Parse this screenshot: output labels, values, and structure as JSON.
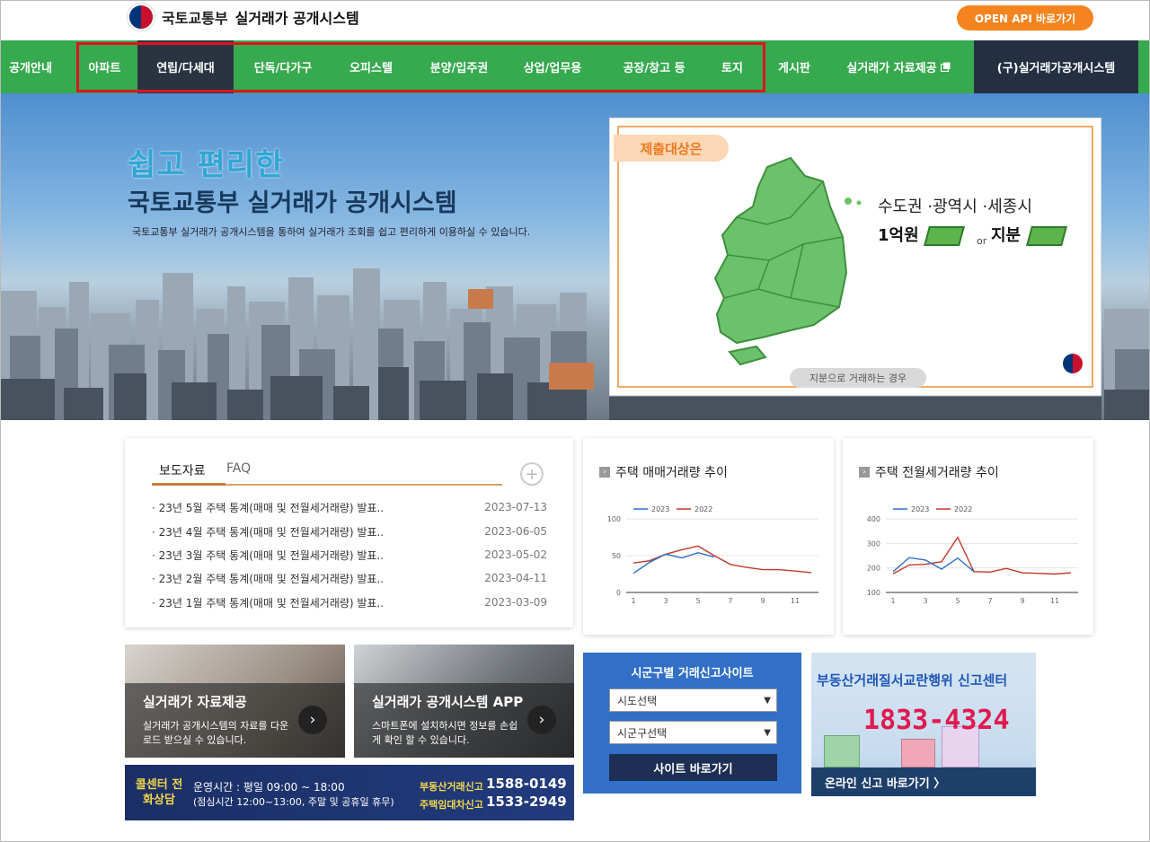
{
  "header": {
    "ministry": "국토교통부",
    "system_name": "실거래가 공개시스템",
    "api_button": "OPEN API 바로가기"
  },
  "nav": {
    "items": [
      {
        "label": "공개안내"
      },
      {
        "label": "아파트"
      },
      {
        "label": "연립/다세대",
        "active": true
      },
      {
        "label": "단독/다가구"
      },
      {
        "label": "오피스텔"
      },
      {
        "label": "분양/입주권"
      },
      {
        "label": "상업/업무용"
      },
      {
        "label": "공장/창고 등"
      },
      {
        "label": "토지"
      },
      {
        "label": "게시판"
      },
      {
        "label": "실거래가 자료제공"
      },
      {
        "label": "(구)실거래가공개시스템"
      }
    ],
    "external_icon": "external-link-icon",
    "colors": {
      "bar": "#37a94f",
      "active": "#2a3441",
      "old_system": "#243042",
      "highlight_box": "#e0141e"
    }
  },
  "hero": {
    "title_line1": "쉽고 편리한",
    "title_line2": "국토교통부 실거래가 공개시스템",
    "description": "국토교통부 실거래가 공개시스템을 통하여 실거래가 조회를 쉽고 편리하게 이용하실 수 있습니다.",
    "promo": {
      "tag": "제출대상은",
      "line1": "수도권 ·광역시 ·세종시",
      "amount": "1억원",
      "or": "or",
      "share": "지분",
      "caption": "지분으로 거래하는 경우",
      "emblem_caption": "국토교통부"
    }
  },
  "news": {
    "tabs": [
      "보도자료",
      "FAQ"
    ],
    "items": [
      {
        "title": "23년 5월 주택 통계(매매 및 전월세거래량) 발표..",
        "date": "2023-07-13"
      },
      {
        "title": "23년 4월 주택 통계(매매 및 전월세거래량) 발표..",
        "date": "2023-06-05"
      },
      {
        "title": "23년 3월 주택 통계(매매 및 전월세거래량) 발표..",
        "date": "2023-05-02"
      },
      {
        "title": "23년 2월 주택 통계(매매 및 전월세거래량) 발표..",
        "date": "2023-04-11"
      },
      {
        "title": "23년 1월 주택 통계(매매 및 전월세거래량) 발표..",
        "date": "2023-03-09"
      }
    ],
    "more_icon": "plus-circle-icon"
  },
  "chart_data": [
    {
      "type": "line",
      "title": "주택 매매거래량 추이",
      "x": [
        1,
        2,
        3,
        4,
        5,
        6,
        7,
        8,
        9,
        10,
        11,
        12
      ],
      "x_ticks": [
        "1",
        "3",
        "5",
        "7",
        "9",
        "11"
      ],
      "ylim": [
        0,
        100
      ],
      "y_ticks": [
        "0",
        "50",
        "100"
      ],
      "grid": true,
      "legend": "top-left",
      "series": [
        {
          "name": "2023",
          "color": "#2f6fc3",
          "values": [
            26,
            41,
            52,
            47,
            54,
            48,
            null,
            null,
            null,
            null,
            null,
            null
          ]
        },
        {
          "name": "2022",
          "color": "#c0392b",
          "values": [
            40,
            43,
            52,
            58,
            63,
            50,
            38,
            34,
            31,
            31,
            29,
            27
          ]
        }
      ]
    },
    {
      "type": "line",
      "title": "주택 전월세거래량 추이",
      "x": [
        1,
        2,
        3,
        4,
        5,
        6,
        7,
        8,
        9,
        10,
        11,
        12
      ],
      "x_ticks": [
        "1",
        "3",
        "5",
        "7",
        "9",
        "11"
      ],
      "ylim": [
        100,
        400
      ],
      "y_ticks": [
        "100",
        "200",
        "300",
        "400"
      ],
      "grid": true,
      "legend": "top-left",
      "series": [
        {
          "name": "2023",
          "color": "#2f6fc3",
          "values": [
            185,
            242,
            232,
            195,
            240,
            185,
            null,
            null,
            null,
            null,
            null,
            null
          ]
        },
        {
          "name": "2022",
          "color": "#c0392b",
          "values": [
            176,
            212,
            215,
            225,
            325,
            185,
            183,
            198,
            180,
            178,
            175,
            180
          ]
        }
      ]
    }
  ],
  "tiles": {
    "data": {
      "title": "실거래가 자료제공",
      "desc": "실거래가 공개시스템의 자료를 다운로드 받으실 수 있습니다."
    },
    "app": {
      "title": "실거래가 공개시스템 APP",
      "desc": "스마트폰에 설치하시면 정보를 손쉽게 확인 할 수 있습니다."
    }
  },
  "callcenter": {
    "label": "콜센터 전화상담",
    "hours": "운영시간 : 평일 09:00 ~ 18:00",
    "lunch": "(점심시간 12:00~13:00, 주말 및 공휴일 휴무)",
    "phones": [
      {
        "label": "부동산거래신고",
        "number": "1588-0149"
      },
      {
        "label": "주택임대차신고",
        "number": "1533-2949"
      }
    ]
  },
  "site_box": {
    "title": "시군구별 거래신고사이트",
    "select1": "시도선택",
    "select2": "시군구선택",
    "go_button": "사이트 바로가기"
  },
  "report_banner": {
    "title": "부동산거래질서교란행위 신고센터",
    "phone": "1833-4324",
    "link": "온라인 신고 바로가기 〉"
  }
}
